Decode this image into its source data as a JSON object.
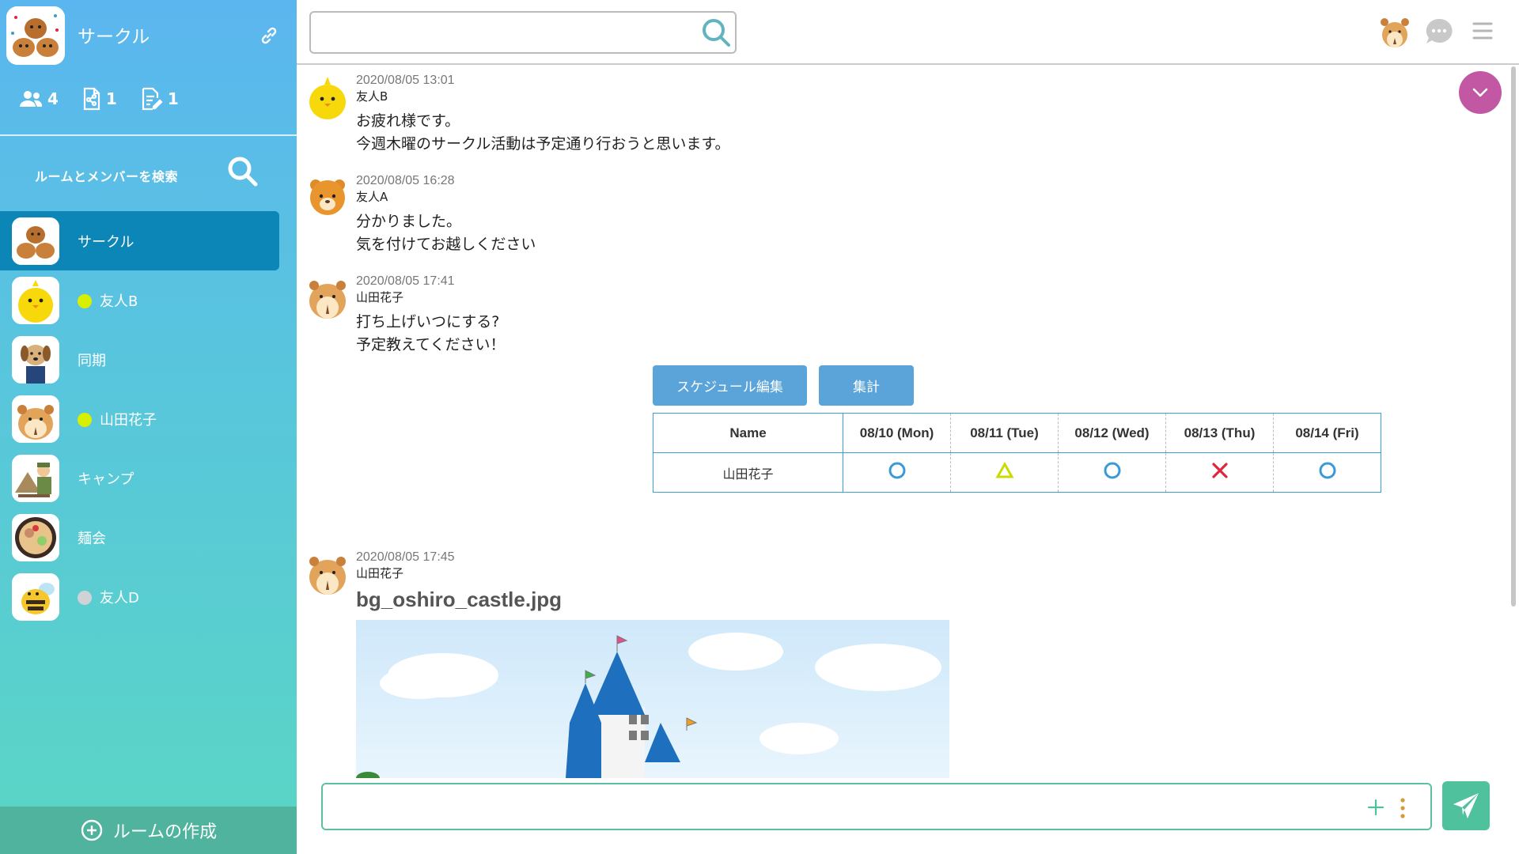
{
  "sidebar": {
    "room_name": "サークル",
    "stats": {
      "members": "4",
      "files": "1",
      "notes": "1"
    },
    "search_label": "ルームとメンバーを検索",
    "rooms": [
      {
        "label": "サークル",
        "active": true,
        "dot": ""
      },
      {
        "label": "友人B",
        "active": false,
        "dot": "#d7ef00"
      },
      {
        "label": "同期",
        "active": false,
        "dot": ""
      },
      {
        "label": "山田花子",
        "active": false,
        "dot": "#d7ef00"
      },
      {
        "label": "キャンプ",
        "active": false,
        "dot": ""
      },
      {
        "label": "麺会",
        "active": false,
        "dot": ""
      },
      {
        "label": "友人D",
        "active": false,
        "dot": "#cfd3d6"
      }
    ],
    "create_label": "ルームの作成"
  },
  "topbar": {
    "search_value": "",
    "search_placeholder": ""
  },
  "messages": [
    {
      "time": "2020/08/05 13:01",
      "sender": "友人B",
      "lines": [
        "お疲れ様です。",
        "今週木曜のサークル活動は予定通り行おうと思います。"
      ]
    },
    {
      "time": "2020/08/05 16:28",
      "sender": "友人A",
      "lines": [
        "分かりました。",
        "気を付けてお越しください"
      ]
    },
    {
      "time": "2020/08/05 17:41",
      "sender": "山田花子",
      "lines": [
        "打ち上げいつにする?",
        "予定教えてください！"
      ]
    },
    {
      "time": "2020/08/05 17:45",
      "sender": "山田花子",
      "filename": "bg_oshiro_castle.jpg"
    }
  ],
  "schedule": {
    "edit_label": "スケジュール編集",
    "tally_label": "集計",
    "headers": [
      "Name",
      "08/10 (Mon)",
      "08/11 (Tue)",
      "08/12 (Wed)",
      "08/13 (Thu)",
      "08/14 (Fri)"
    ],
    "rows": [
      {
        "name": "山田花子",
        "marks": [
          "circle",
          "triangle",
          "circle",
          "cross",
          "circle"
        ]
      }
    ]
  },
  "composer": {
    "value": "",
    "placeholder": ""
  },
  "colors": {
    "active_room": "#0b86b7",
    "button": "#5ba4d9",
    "send": "#4fc19c",
    "circle": "#3a9ad9",
    "triangle": "#c8dc00",
    "cross": "#e0263c",
    "scroll_down": "#c257a4"
  }
}
